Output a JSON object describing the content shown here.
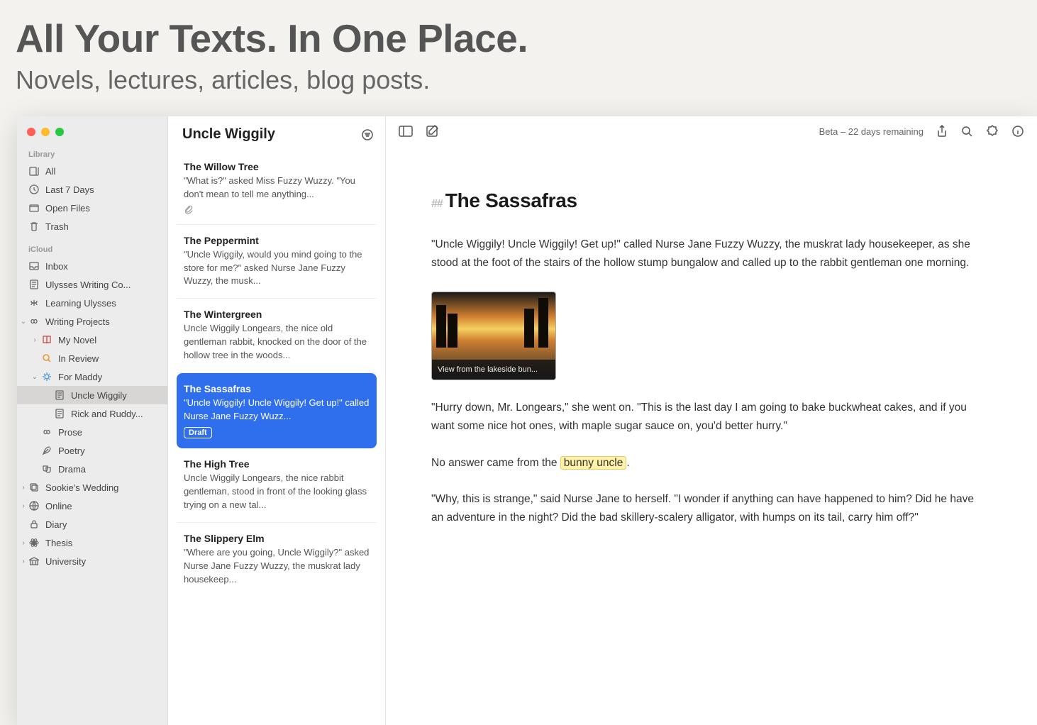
{
  "hero": {
    "title": "All Your Texts. In One Place.",
    "subtitle": "Novels, lectures, articles, blog posts."
  },
  "sidebar": {
    "sections": {
      "library": {
        "label": "Library",
        "items": [
          {
            "label": "All"
          },
          {
            "label": "Last 7 Days"
          },
          {
            "label": "Open Files"
          },
          {
            "label": "Trash"
          }
        ]
      },
      "icloud": {
        "label": "iCloud",
        "items": [
          {
            "label": "Inbox"
          },
          {
            "label": "Ulysses Writing Co..."
          },
          {
            "label": "Learning Ulysses"
          },
          {
            "label": "Writing Projects",
            "chevron": "down"
          },
          {
            "label": "My Novel",
            "indent": 1,
            "chevron": "right",
            "icon": "book-red"
          },
          {
            "label": "In Review",
            "indent": 1,
            "icon": "magnify-orange"
          },
          {
            "label": "For Maddy",
            "indent": 1,
            "chevron": "down",
            "icon": "sun-blue"
          },
          {
            "label": "Uncle Wiggily",
            "indent": 2,
            "selected": true,
            "icon": "page"
          },
          {
            "label": "Rick and Ruddy...",
            "indent": 2,
            "icon": "page"
          },
          {
            "label": "Prose",
            "indent": 1,
            "icon": "infinity"
          },
          {
            "label": "Poetry",
            "indent": 1,
            "icon": "feather"
          },
          {
            "label": "Drama",
            "indent": 1,
            "icon": "masks"
          },
          {
            "label": "Sookie's Wedding",
            "chevron": "right",
            "icon": "stack"
          },
          {
            "label": "Online",
            "chevron": "right",
            "icon": "globe"
          },
          {
            "label": "Diary",
            "icon": "lock"
          },
          {
            "label": "Thesis",
            "chevron": "right",
            "icon": "atom"
          },
          {
            "label": "University",
            "chevron": "right",
            "icon": "library"
          }
        ]
      }
    }
  },
  "middle": {
    "title": "Uncle Wiggily",
    "items": [
      {
        "title": "The Willow Tree",
        "preview": "\"What is?\" asked Miss Fuzzy Wuzzy. \"You don't mean to tell me anything...",
        "attachment": true
      },
      {
        "title": "The Peppermint",
        "preview": "\"Uncle Wiggily, would you mind going to the store for me?\" asked Nurse Jane Fuzzy Wuzzy, the musk..."
      },
      {
        "title": "The Wintergreen",
        "preview": "Uncle Wiggily Longears, the nice old gentleman rabbit, knocked on the door of the hollow tree in the woods..."
      },
      {
        "title": "The Sassafras",
        "preview": "\"Uncle Wiggily! Uncle Wiggily! Get up!\" called Nurse Jane Fuzzy Wuzz...",
        "selected": true,
        "badge": "Draft"
      },
      {
        "title": "The High Tree",
        "preview": "Uncle Wiggily Longears, the nice rabbit gentleman, stood in front of the looking glass trying on a new tal..."
      },
      {
        "title": "The Slippery Elm",
        "preview": "\"Where are you going, Uncle Wiggily?\" asked Nurse Jane Fuzzy Wuzzy, the muskrat lady housekeep..."
      }
    ]
  },
  "toolbar": {
    "beta": "Beta – 22 days remaining"
  },
  "document": {
    "hash_prefix": "##",
    "title": "The Sassafras",
    "p1": "\"Uncle Wiggily! Uncle Wiggily! Get up!\" called Nurse Jane Fuzzy Wuzzy, the muskrat lady housekeeper, as she stood at the foot of the stairs of the hollow stump bungalow and called up to the rabbit gentleman one morning.",
    "image_caption": "View from the lakeside bun...",
    "p2": "\"Hurry down, Mr. Longears,\" she went on. \"This is the last day I am going to bake buckwheat cakes, and if you want some nice hot ones, with maple sugar sauce on, you'd better hurry.\"",
    "p3_before": "No answer came from the ",
    "p3_highlight": "bunny uncle",
    "p3_after": ".",
    "p4": "\"Why, this is strange,\" said Nurse Jane to herself. \"I wonder if anything can have happened to him? Did he have an adventure in the night? Did the bad skillery-scalery alligator, with humps on its tail, carry him off?\""
  }
}
